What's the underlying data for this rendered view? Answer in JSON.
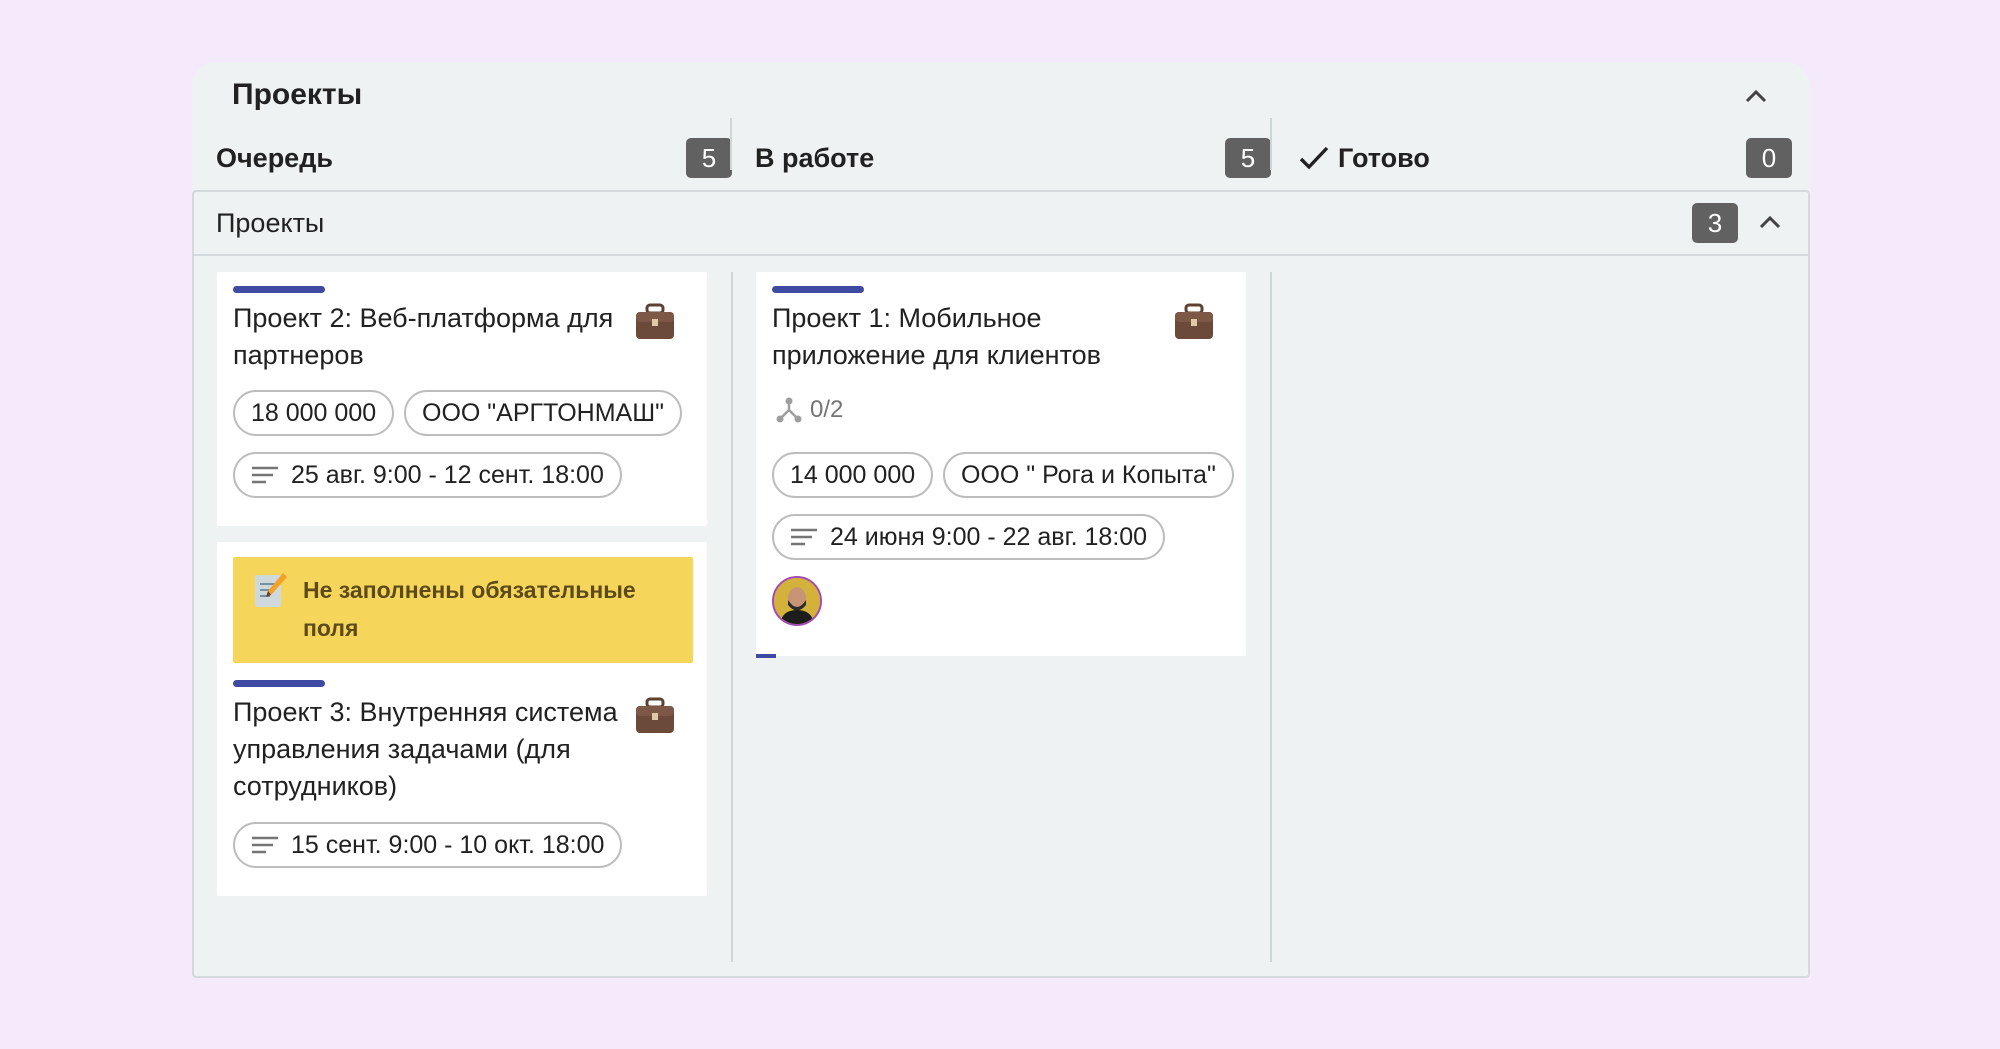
{
  "board": {
    "title": "Проекты",
    "columns": [
      {
        "label": "Очередь",
        "count": "5"
      },
      {
        "label": "В работе",
        "count": "5"
      },
      {
        "label": "Готово",
        "count": "0"
      }
    ]
  },
  "group": {
    "title": "Проекты",
    "count": "3"
  },
  "cards": {
    "p2": {
      "title": "Проект 2: Веб-платформа для партнеров",
      "amount": "18 000 000",
      "company": "ООО \"АРГТОНМАШ\"",
      "dates": "25 авг. 9:00 - 12 сент. 18:00"
    },
    "p3": {
      "warning": "Не заполнены обязательные поля",
      "title": "Проект 3: Внутренняя система управления задачами (для сотрудников)",
      "dates": "15 сент. 9:00 - 10 окт. 18:00"
    },
    "p1": {
      "title": "Проект 1: Мобильное приложение для клиентов",
      "subtasks": "0/2",
      "amount": "14 000 000",
      "company": "ООО \" Рога и Копыта\"",
      "dates": "24 июня 9:00 - 22 авг. 18:00"
    }
  },
  "icons": [
    "chevron-up-icon",
    "check-icon",
    "briefcase-icon",
    "description-icon",
    "memo-icon",
    "subtask-icon",
    "avatar"
  ],
  "colors": {
    "accent": "#3f4aa3",
    "warning": "#f6d65a",
    "badge": "#616161",
    "page": "#f4eafc"
  }
}
